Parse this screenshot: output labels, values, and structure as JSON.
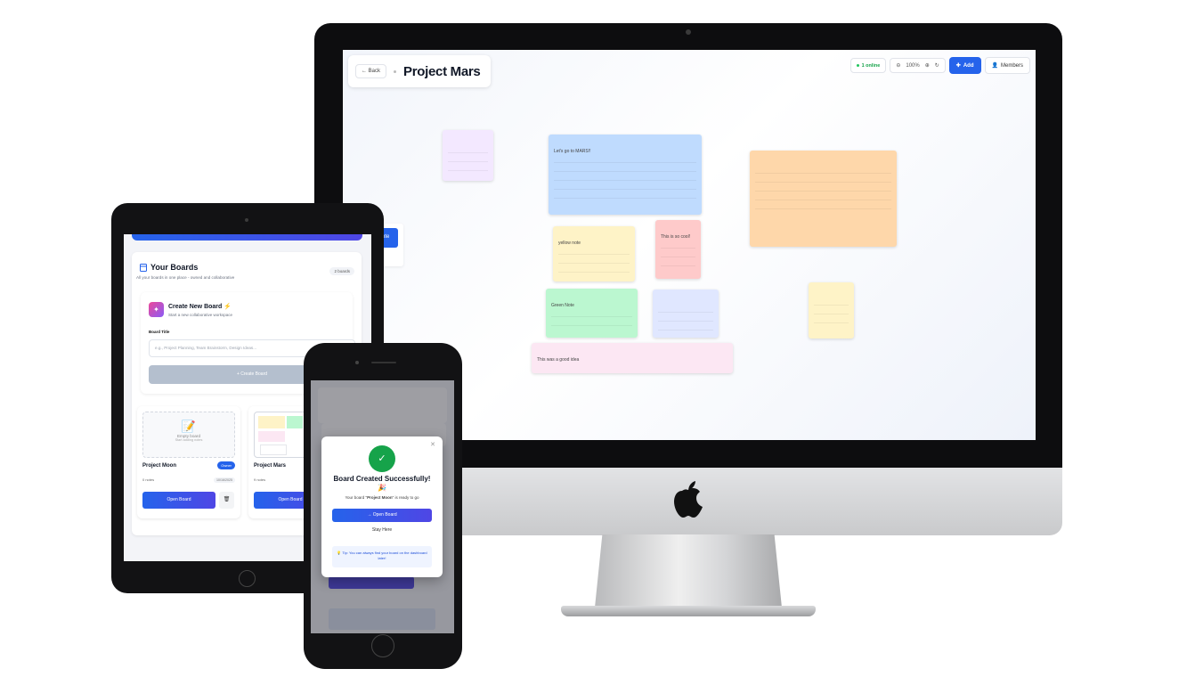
{
  "desktop": {
    "back_label": "← Back",
    "board_title": "Project Mars",
    "online_label": "1 online",
    "zoom_level": "100%",
    "add_label": "Add",
    "members_label": "Members",
    "notes": [
      {
        "text": "",
        "color": "#f3e8ff"
      },
      {
        "text": "Let's go to MARS!!",
        "color": "#bfdbfe"
      },
      {
        "text": "",
        "color": "#fed7aa"
      },
      {
        "text": "yellow note",
        "color": "#fef3c7"
      },
      {
        "text": "This is so cool!",
        "color": "#fecaca"
      },
      {
        "text": "Green Note",
        "color": "#bbf7d0"
      },
      {
        "text": "",
        "color": "#e0e7ff"
      },
      {
        "text": "",
        "color": "#fef3c7"
      },
      {
        "text": "This was a good idea",
        "color": "#fce7f3"
      }
    ],
    "peek_label": "ote",
    "peek_sub": "sting soon"
  },
  "tablet": {
    "your_boards_title": "Your Boards",
    "your_boards_sub": "All your boards in one place - owned and collaborative",
    "board_count": "2 boards",
    "create_title": "Create New Board",
    "create_sub": "Start a new collaborative workspace",
    "field_label": "Board Title",
    "title_placeholder": "e.g., Project Planning, Team Brainstorm, Design Ideas...",
    "create_button": "+ Create Board",
    "boards": [
      {
        "name": "Project Moon",
        "badge": "Owner",
        "meta": "0 notes",
        "date": "10/16/2025",
        "thumb_title": "Empty board",
        "thumb_hint": "Start adding notes",
        "open": "Open Board"
      },
      {
        "name": "Project Mars",
        "meta": "9 notes",
        "open": "Open Board"
      }
    ]
  },
  "phone": {
    "modal_title": "Board Created Successfully! 🎉",
    "modal_msg_prefix": "Your board \"",
    "modal_board": "Project Moon",
    "modal_msg_suffix": "\" is ready to go",
    "open_button": "→ Open Board",
    "stay_button": "Stay Here",
    "tip": "💡 Tip: You can always find your board on the dashboard later!"
  }
}
